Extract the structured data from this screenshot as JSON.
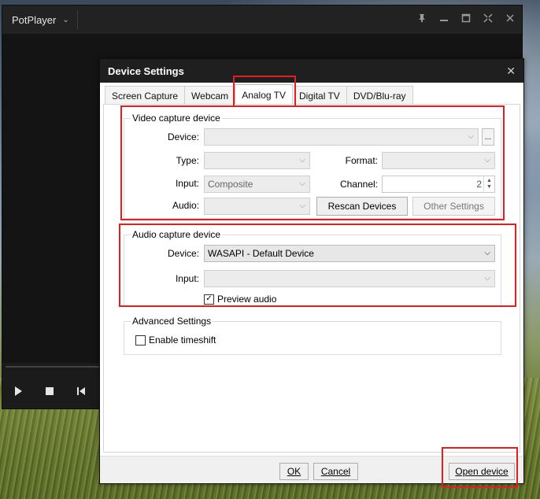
{
  "player": {
    "title": "PotPlayer",
    "title_caret": "⌄",
    "window_buttons": [
      "pin-icon",
      "minimize-icon",
      "maximize-icon",
      "fullscreen-icon",
      "close-icon"
    ]
  },
  "dialog": {
    "title": "Device Settings",
    "close_glyph": "✕",
    "tabs": [
      "Screen Capture",
      "Webcam",
      "Analog TV",
      "Digital TV",
      "DVD/Blu-ray"
    ],
    "active_tab": "Analog TV",
    "video": {
      "legend": "Video capture device",
      "device_label": "Device:",
      "device_value": "",
      "browse_label": "...",
      "type_label": "Type:",
      "type_value": "",
      "format_label": "Format:",
      "format_value": "",
      "input_label": "Input:",
      "input_value": "Composite",
      "channel_label": "Channel:",
      "channel_value": "2",
      "audio_label": "Audio:",
      "audio_value": "",
      "rescan_label": "Rescan Devices",
      "other_settings_label": "Other Settings"
    },
    "audio": {
      "legend": "Audio capture device",
      "device_label": "Device:",
      "device_value": "WASAPI - Default Device",
      "input_label": "Input:",
      "input_value": "",
      "preview_label": "Preview audio",
      "preview_checked": true
    },
    "advanced": {
      "legend": "Advanced Settings",
      "timeshift_label": "Enable timeshift",
      "timeshift_checked": false
    },
    "footer": {
      "ok_label": "OK",
      "cancel_label": "Cancel",
      "open_device_label": "Open device"
    }
  },
  "colors": {
    "highlight": "#e02020",
    "dialog_titlebar": "#1f1f1f",
    "player_bg": "#1b1b1b"
  }
}
